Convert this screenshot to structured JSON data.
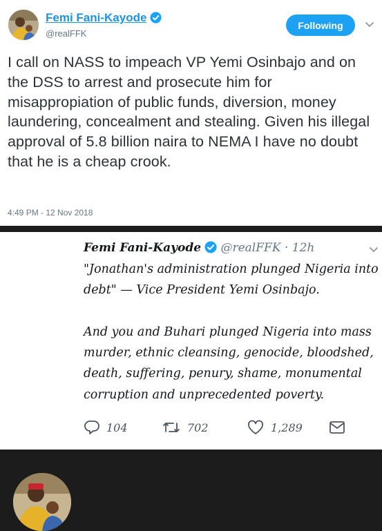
{
  "tweet1": {
    "name": "Femi Fani-Kayode",
    "handle": "@realFFK",
    "follow_label": "Following",
    "text": "I call on NASS to impeach VP Yemi Osinbajo and on the DSS to arrest and prosecute him for misappropiation of public funds, diversion, money laundering, concealment and stealing. Given his illegal approval of 5.8 billion naira to NEMA I have no doubt that he is a cheap crook.",
    "timestamp": "4:49 PM - 12 Nov 2018"
  },
  "tweet2": {
    "name": "Femi Fani-Kayode",
    "handle": "@realFFK",
    "separator": "·",
    "age": "12h",
    "text": "\"Jonathan's administration plunged Nigeria into debt\" — Vice President Yemi Osinbajo.\n\nAnd you and Buhari plunged Nigeria into mass murder, ethnic cleansing, genocide, bloodshed, death, suffering, penury, shame, monumental corruption and unprecedented poverty.",
    "replies": "104",
    "retweets": "702",
    "likes": "1,289"
  },
  "colors": {
    "accent": "#1da1f2",
    "name_link": "#1b95e0",
    "muted": "#657786"
  },
  "icons": [
    "verified-badge-icon",
    "chevron-down-icon",
    "reply-icon",
    "retweet-icon",
    "like-icon",
    "message-icon"
  ]
}
